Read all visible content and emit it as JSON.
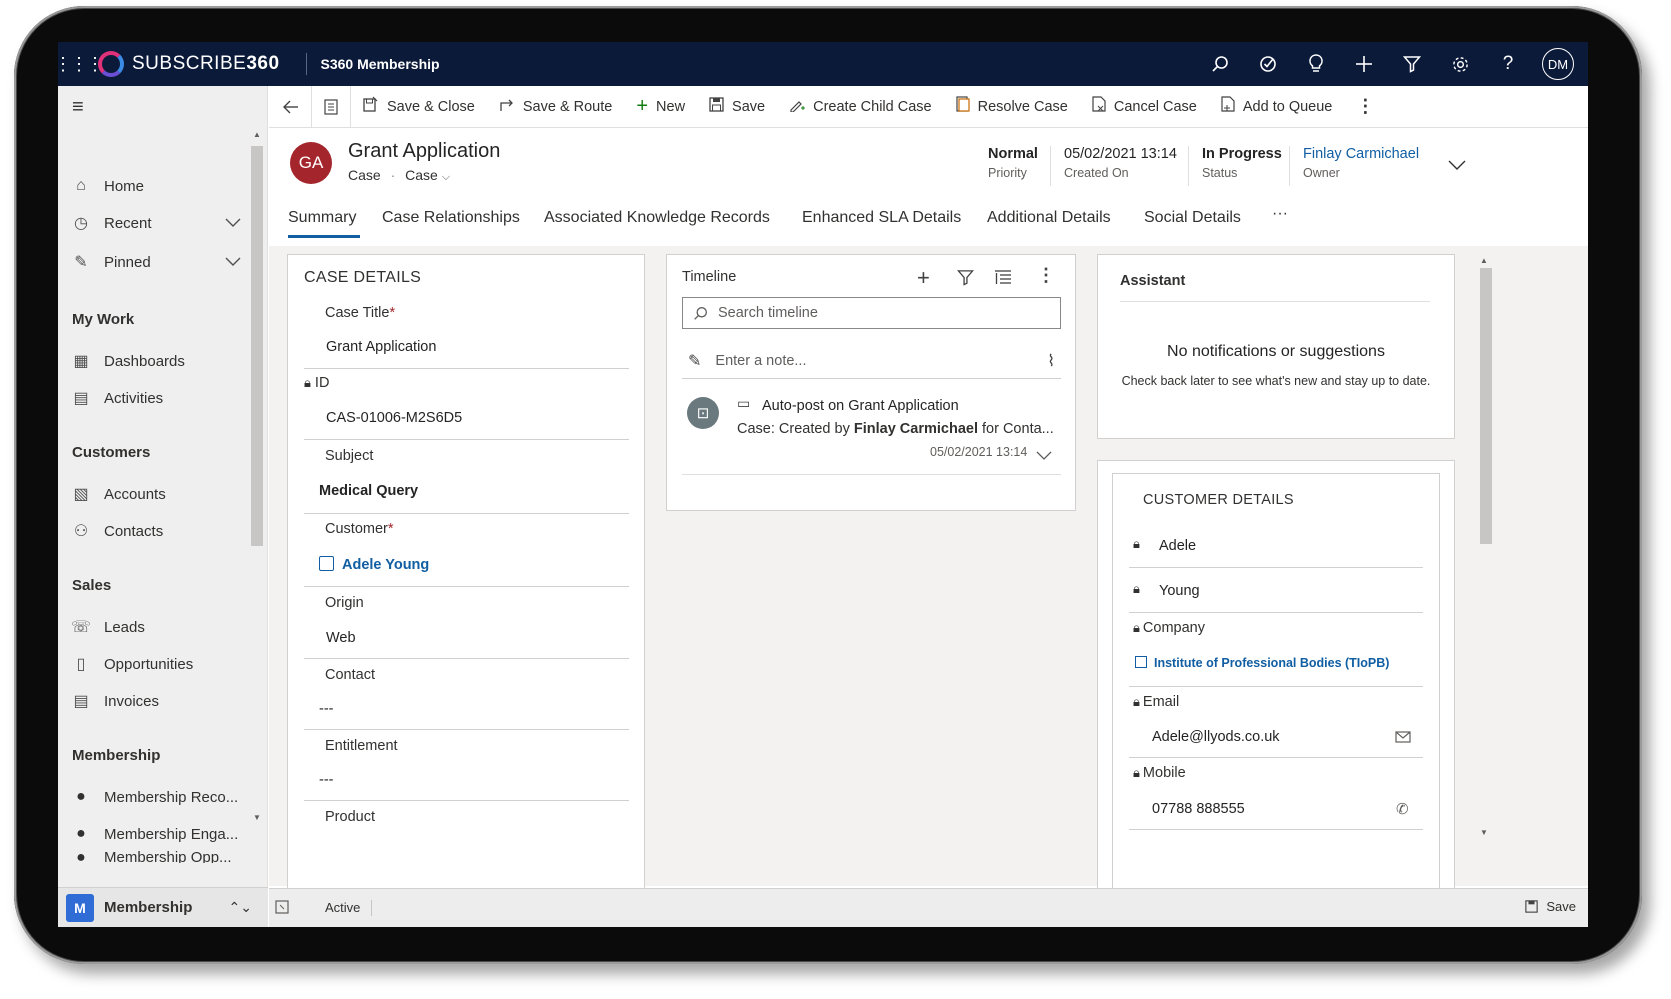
{
  "topbar": {
    "brand_prefix": "SUBSCRIBE",
    "brand_suffix": "360",
    "app_name": "S360 Membership",
    "user_initials": "DM"
  },
  "sidebar": {
    "items_top": [
      {
        "label": "Home",
        "icon": "home-icon"
      },
      {
        "label": "Recent",
        "icon": "clock-icon"
      },
      {
        "label": "Pinned",
        "icon": "pin-icon"
      }
    ],
    "group_my_work": "My Work",
    "my_work": [
      {
        "label": "Dashboards"
      },
      {
        "label": "Activities"
      }
    ],
    "group_customers": "Customers",
    "customers": [
      {
        "label": "Accounts"
      },
      {
        "label": "Contacts"
      }
    ],
    "group_sales": "Sales",
    "sales": [
      {
        "label": "Leads"
      },
      {
        "label": "Opportunities"
      },
      {
        "label": "Invoices"
      }
    ],
    "group_membership": "Membership",
    "membership": [
      {
        "label": "Membership Reco..."
      },
      {
        "label": "Membership Enga..."
      },
      {
        "label": "Membership Opp..."
      }
    ],
    "area": {
      "badge": "M",
      "label": "Membership"
    }
  },
  "commands": {
    "save_close": "Save & Close",
    "save_route": "Save & Route",
    "new": "New",
    "save": "Save",
    "create_child": "Create Child Case",
    "resolve": "Resolve Case",
    "cancel": "Cancel Case",
    "add_queue": "Add to Queue"
  },
  "record": {
    "initials": "GA",
    "title": "Grant Application",
    "entity": "Case",
    "form": "Case",
    "priority_value": "Normal",
    "priority_label": "Priority",
    "created_value": "05/02/2021 13:14",
    "created_label": "Created On",
    "status_value": "In Progress",
    "status_label": "Status",
    "owner_value": "Finlay Carmichael",
    "owner_label": "Owner"
  },
  "tabs": [
    "Summary",
    "Case Relationships",
    "Associated Knowledge Records",
    "Enhanced SLA Details",
    "Additional Details",
    "Social Details",
    "···"
  ],
  "case_details": {
    "title": "CASE DETAILS",
    "case_title_label": "Case Title",
    "case_title_value": "Grant Application",
    "id_label": "ID",
    "id_value": "CAS-01006-M2S6D5",
    "subject_label": "Subject",
    "subject_value": "Medical Query",
    "customer_label": "Customer",
    "customer_value": "Adele Young",
    "origin_label": "Origin",
    "origin_value": "Web",
    "contact_label": "Contact",
    "contact_value": "---",
    "entitlement_label": "Entitlement",
    "entitlement_value": "---",
    "product_label": "Product",
    "required_mark": "*"
  },
  "timeline": {
    "title": "Timeline",
    "search_placeholder": "Search timeline",
    "note_placeholder": "Enter a note...",
    "post_title": "Auto-post on Grant Application",
    "post_prefix": "Case: Created by ",
    "post_author": "Finlay Carmichael",
    "post_suffix": " for Conta...",
    "post_time": "05/02/2021 13:14"
  },
  "assistant": {
    "title": "Assistant",
    "empty_title": "No notifications or suggestions",
    "empty_sub": "Check back later to see what's new and stay up to date."
  },
  "customer_details": {
    "title": "CUSTOMER DETAILS",
    "first_name": "Adele",
    "last_name": "Young",
    "company_label": "Company",
    "company_value": "Institute of Professional Bodies (TIoPB)",
    "email_label": "Email",
    "email_value": "Adele@llyods.co.uk",
    "mobile_label": "Mobile",
    "mobile_value": "07788 888555"
  },
  "statusbar": {
    "status": "Active",
    "save": "Save"
  }
}
